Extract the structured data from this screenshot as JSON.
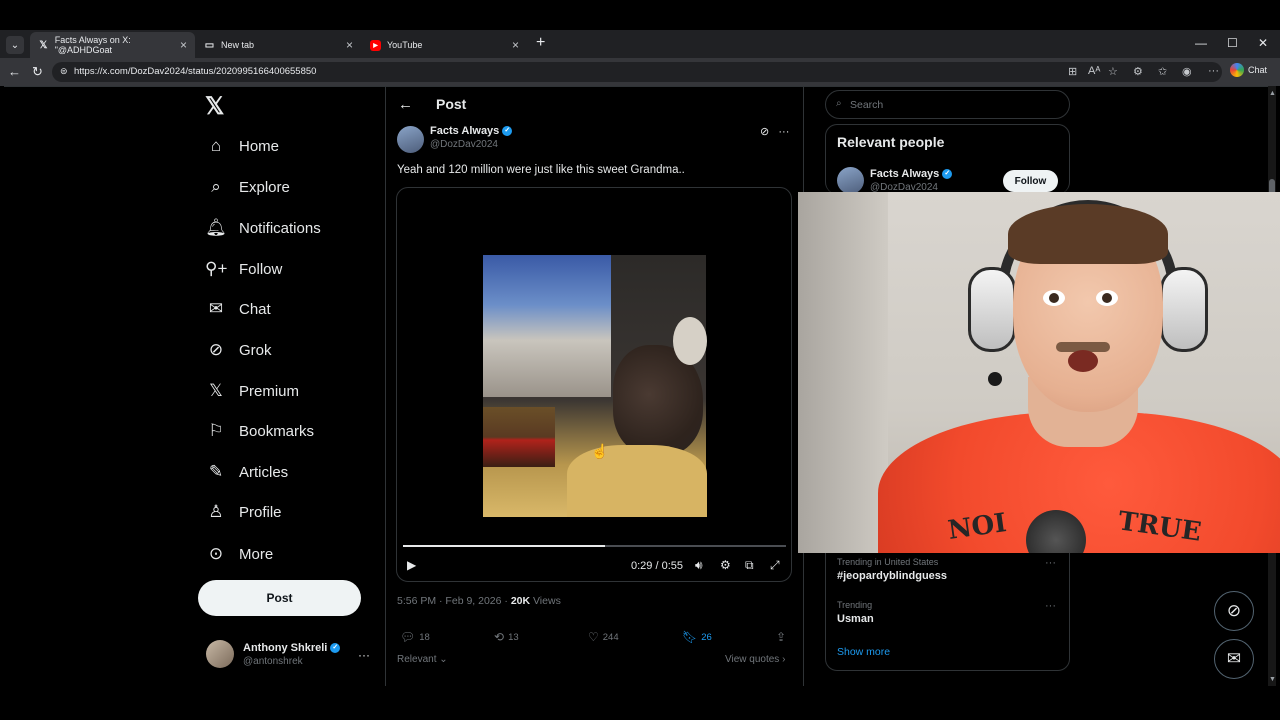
{
  "browser": {
    "tabs": [
      {
        "title": "Facts Always on X: \"@ADHDGoat",
        "icon": "x-logo-icon",
        "active": true
      },
      {
        "title": "New tab",
        "icon": "new-tab-icon",
        "active": false
      },
      {
        "title": "YouTube",
        "icon": "youtube-icon",
        "active": false
      }
    ],
    "url": "https://x.com/DozDav2024/status/2020995166400655850",
    "chat_label": "Chat"
  },
  "nav": {
    "items": [
      {
        "label": "Home",
        "icon": "home-icon"
      },
      {
        "label": "Explore",
        "icon": "search-icon"
      },
      {
        "label": "Notifications",
        "icon": "bell-icon"
      },
      {
        "label": "Follow",
        "icon": "follow-icon"
      },
      {
        "label": "Chat",
        "icon": "mail-icon"
      },
      {
        "label": "Grok",
        "icon": "grok-icon"
      },
      {
        "label": "Premium",
        "icon": "x-logo-icon"
      },
      {
        "label": "Bookmarks",
        "icon": "bookmark-icon"
      },
      {
        "label": "Articles",
        "icon": "articles-icon"
      },
      {
        "label": "Profile",
        "icon": "user-icon"
      },
      {
        "label": "More",
        "icon": "more-circle-icon"
      }
    ],
    "post_button": "Post",
    "account": {
      "name": "Anthony Shkreli",
      "handle": "@antonshrek"
    }
  },
  "post": {
    "header_title": "Post",
    "author_name": "Facts Always",
    "author_handle": "@DozDav2024",
    "text": "Yeah and 120 million were just like this sweet Grandma..",
    "video": {
      "time": "0:29 / 0:55",
      "progress": 0.527
    },
    "timestamp": "5:56 PM · Feb 9, 2026 · ",
    "views_count": "20K",
    "views_label": " Views",
    "stats": {
      "replies": "18",
      "reposts": "13",
      "likes": "244",
      "bookmarks": "26"
    },
    "relevant_label": "Relevant",
    "view_quotes_label": "View quotes"
  },
  "sidebar": {
    "search_placeholder": "Search",
    "relevant_title": "Relevant people",
    "person_name": "Facts Always",
    "person_handle": "@DozDav2024",
    "follow_label": "Follow",
    "trends": [
      {
        "meta": "Trending in United States",
        "topic": "#jeopardyblindguess"
      },
      {
        "meta": "Trending",
        "topic": "Usman"
      }
    ],
    "show_more": "Show more"
  },
  "colors": {
    "accent": "#1d9bf0",
    "background": "#000000",
    "text": "#e7e9ea",
    "muted": "#71767b"
  }
}
